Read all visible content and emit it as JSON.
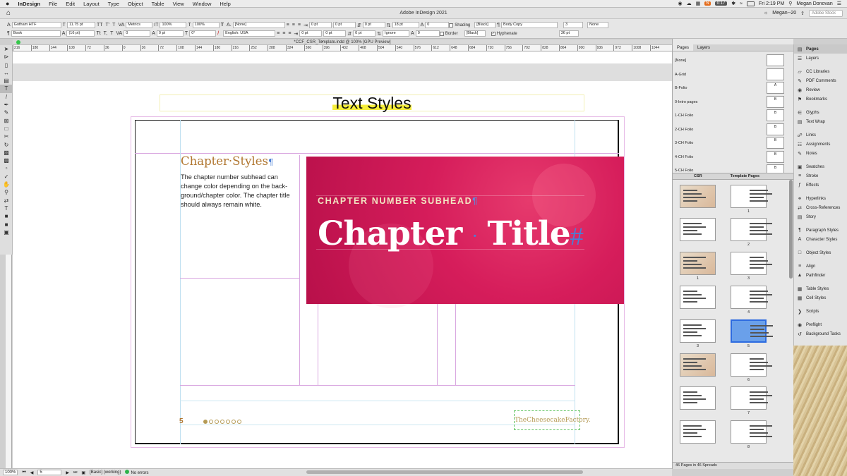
{
  "menubar": {
    "apple": "",
    "app": "InDesign",
    "items": [
      "File",
      "Edit",
      "Layout",
      "Type",
      "Object",
      "Table",
      "View",
      "Window",
      "Help"
    ],
    "battery": "0:17",
    "clock": "Fri 2:19 PM",
    "user": "Megan Donovan"
  },
  "titlebar": {
    "title": "Adobe InDesign 2021",
    "workspace": "Megan--20",
    "stock_placeholder": "Adobe Stock"
  },
  "control": {
    "font_family": "Gotham HTF",
    "font_style": "Book",
    "font_size": "11.75 pt",
    "leading": "(16 pt)",
    "kerning": "Metrics",
    "tracking": "0",
    "vscale": "100%",
    "hscale": "100%",
    "baseline": "0 pt",
    "skew": "0°",
    "char_style": "[None]",
    "language": "English: USA",
    "indent_left": "0 pt",
    "indent_first": "0 pt",
    "indent_right": "0 pt",
    "indent_last": "0 pt",
    "space_before": "0 pt",
    "space_after": "0 pt",
    "grid_align": "Ignore",
    "leading2": "18 pt",
    "drop_cap": "0",
    "drop_cap2": "0",
    "shading": "Shading",
    "border": "Border",
    "swatch1": "[Black]",
    "swatch2": "[Black]",
    "para_style": "Body Copy",
    "hyphenate": "Hyphenate",
    "columns": "3",
    "gutter": "36 pt",
    "bullets": "None"
  },
  "doc": {
    "tab_title": "*CCF_CSR_Template.indd @ 100% [GPU Preview]"
  },
  "ruler": [
    "216",
    "180",
    "144",
    "108",
    "72",
    "36",
    "0",
    "36",
    "72",
    "108",
    "144",
    "180",
    "216",
    "252",
    "288",
    "324",
    "360",
    "396",
    "432",
    "468",
    "504",
    "540",
    "576",
    "612",
    "648",
    "684",
    "720",
    "756",
    "792",
    "828",
    "864",
    "900",
    "936",
    "972",
    "1008",
    "1044"
  ],
  "page": {
    "header": "Text Styles",
    "chapter_styles": "Chapter·Styles",
    "pilcrow": "¶",
    "description": "The chapter number subhead can change color depending on the back-ground/chapter color. The chapter title should always remain white.",
    "subhead": "CHAPTER NUMBER SUBHEAD",
    "title_a": "Chapter",
    "title_dot": "·",
    "title_b": "Title",
    "title_end": "#",
    "folio": "5",
    "logo": "TheCheesecakeFactory."
  },
  "status": {
    "zoom": "100%",
    "page": "5",
    "profile": "[Basic] (working)",
    "errors": "No errors"
  },
  "pages_panel": {
    "tab_pages": "Pages",
    "tab_layers": "Layers",
    "masters": [
      {
        "name": "[None]",
        "label": ""
      },
      {
        "name": "A-Grid",
        "label": ""
      },
      {
        "name": "B-Folio",
        "label": "A"
      },
      {
        "name": "0-Intro pages",
        "label": "B"
      },
      {
        "name": "1-CH Folio",
        "label": "B"
      },
      {
        "name": "2-CH Folio",
        "label": "B"
      },
      {
        "name": "3-CH Folio",
        "label": "B"
      },
      {
        "name": "4-CH Folio",
        "label": "B"
      },
      {
        "name": "5-CH Folio",
        "label": "B"
      }
    ],
    "col_left": "CSR",
    "col_right": "Template Pages",
    "left_nums": [
      "",
      "",
      "1",
      "",
      "3",
      "",
      "",
      ""
    ],
    "right_nums": [
      "1",
      "2",
      "3",
      "4",
      "5",
      "6",
      "7",
      "8"
    ],
    "bottom_left": [
      "2",
      "4",
      "5",
      "6",
      "7"
    ],
    "footer": "46 Pages in 46 Spreads"
  },
  "side_panels": [
    "Pages",
    "Layers",
    "CC Libraries",
    "PDF Comments",
    "Review",
    "Bookmarks",
    "Glyphs",
    "Text Wrap",
    "Links",
    "Assignments",
    "Notes",
    "Swatches",
    "Stroke",
    "Effects",
    "Hyperlinks",
    "Cross-References",
    "Story",
    "Paragraph Styles",
    "Character Styles",
    "Object Styles",
    "Align",
    "Pathfinder",
    "Table Styles",
    "Cell Styles",
    "Scripts",
    "Preflight",
    "Background Tasks"
  ],
  "colors": {
    "hero": "#d61d5b",
    "gold": "#b0762f",
    "pilcrow": "#4a7fd6"
  }
}
